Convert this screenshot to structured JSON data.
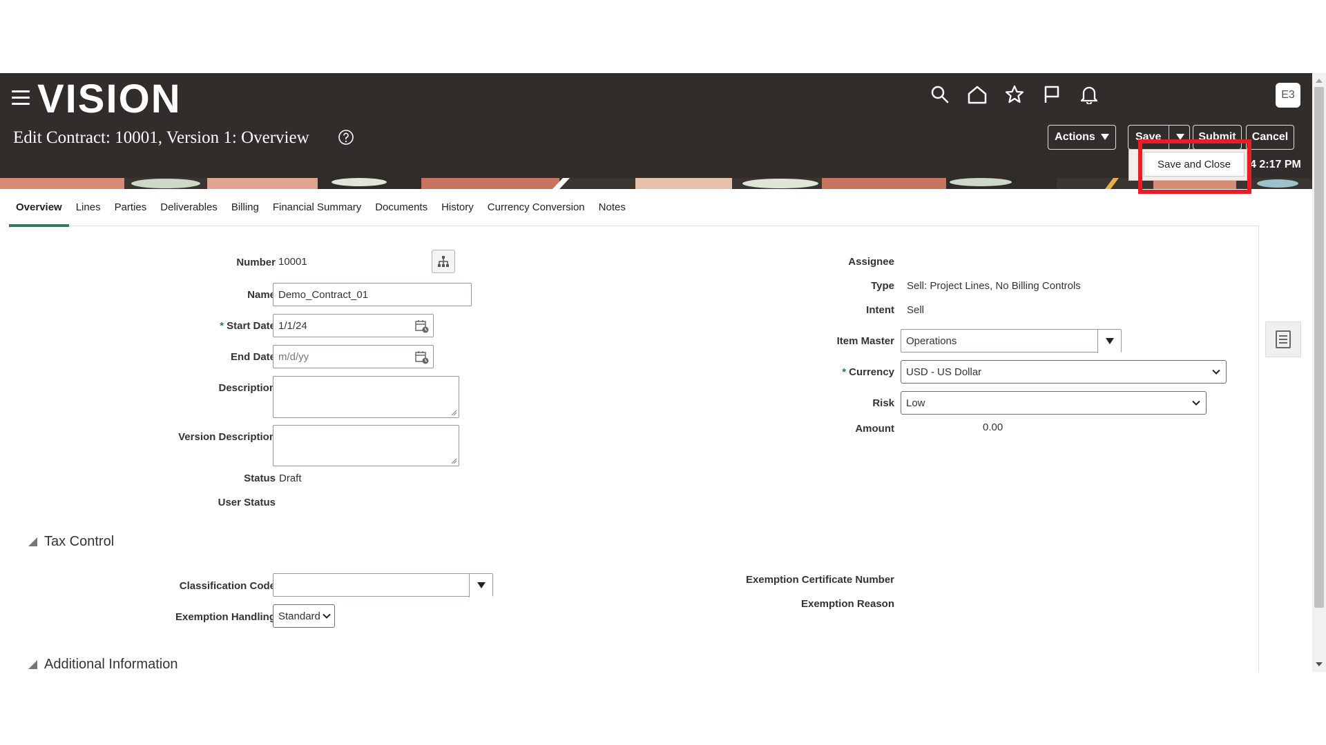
{
  "app": {
    "logo": "VISION",
    "avatar_initials": "E3",
    "page_title": "Edit Contract: 10001, Version 1: Overview",
    "time_text": "4 2:17 PM"
  },
  "header_icons": [
    "search-icon",
    "home-icon",
    "star-icon",
    "flag-icon",
    "bell-icon"
  ],
  "buttons": {
    "actions": "Actions",
    "save": "Save",
    "submit": "Submit",
    "cancel": "Cancel"
  },
  "menu": {
    "save_and_close": "Save and Close"
  },
  "tabs": [
    "Overview",
    "Lines",
    "Parties",
    "Deliverables",
    "Billing",
    "Financial Summary",
    "Documents",
    "History",
    "Currency Conversion",
    "Notes"
  ],
  "left_form": {
    "number_label": "Number",
    "number_value": "10001",
    "name_label": "Name",
    "name_value": "Demo_Contract_01",
    "start_date_label": "Start Date",
    "start_date_value": "1/1/24",
    "end_date_label": "End Date",
    "end_date_placeholder": "m/d/yy",
    "description_label": "Description",
    "version_description_label": "Version Description",
    "status_label": "Status",
    "status_value": "Draft",
    "user_status_label": "User Status"
  },
  "right_form": {
    "assignee_label": "Assignee",
    "type_label": "Type",
    "type_value": "Sell: Project Lines, No Billing Controls",
    "intent_label": "Intent",
    "intent_value": "Sell",
    "item_master_label": "Item Master",
    "item_master_value": "Operations",
    "currency_label": "Currency",
    "currency_value": "USD - US Dollar",
    "risk_label": "Risk",
    "risk_value": "Low",
    "amount_label": "Amount",
    "amount_value": "0.00"
  },
  "tax_control": {
    "title": "Tax Control",
    "classification_code_label": "Classification Code",
    "exemption_handling_label": "Exemption Handling",
    "exemption_handling_value": "Standard",
    "exemption_certificate_label": "Exemption Certificate Number",
    "exemption_reason_label": "Exemption Reason"
  },
  "additional_information": {
    "title": "Additional Information"
  },
  "colors": {
    "header_bg": "#312d2a",
    "tab_underline": "#2f7a5d",
    "highlight": "#ec1c24"
  }
}
